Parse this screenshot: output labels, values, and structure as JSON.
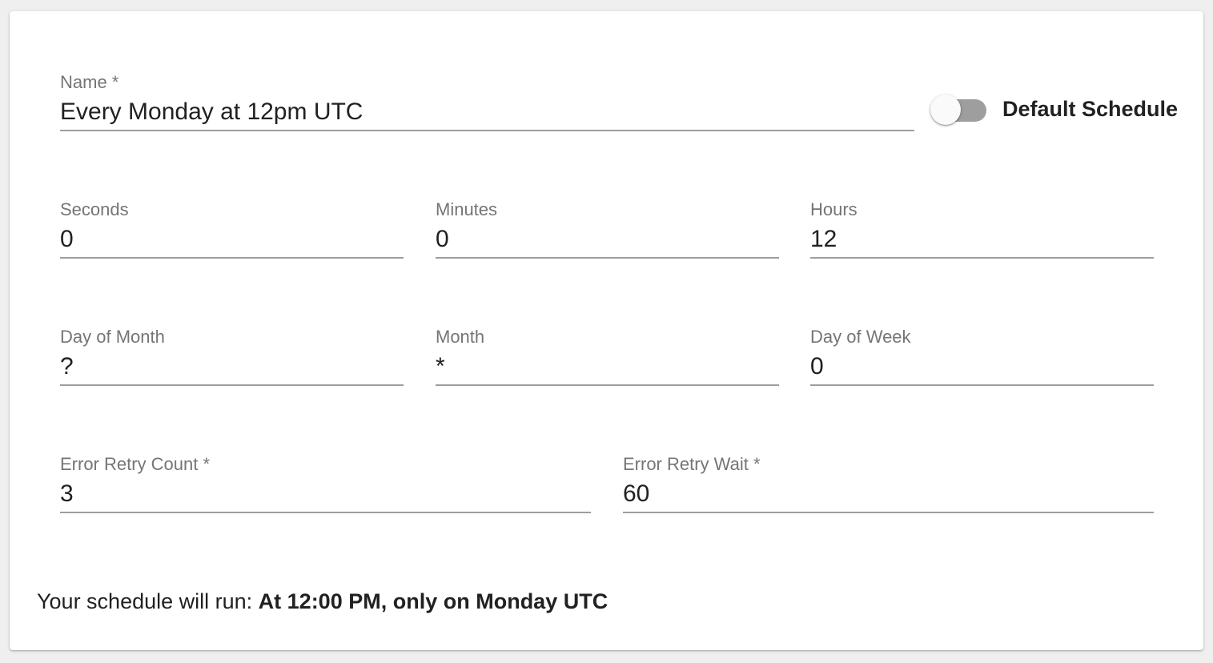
{
  "form": {
    "name": {
      "label": "Name *",
      "value": "Every Monday at 12pm UTC"
    },
    "default_schedule": {
      "label": "Default Schedule",
      "checked": false
    },
    "seconds": {
      "label": "Seconds",
      "value": "0"
    },
    "minutes": {
      "label": "Minutes",
      "value": "0"
    },
    "hours": {
      "label": "Hours",
      "value": "12"
    },
    "day_of_month": {
      "label": "Day of Month",
      "value": "?"
    },
    "month": {
      "label": "Month",
      "value": "*"
    },
    "day_of_week": {
      "label": "Day of Week",
      "value": "0"
    },
    "error_retry_count": {
      "label": "Error Retry Count *",
      "value": "3"
    },
    "error_retry_wait": {
      "label": "Error Retry Wait *",
      "value": "60"
    }
  },
  "summary": {
    "prefix": "Your schedule will run: ",
    "description": "At 12:00 PM, only on Monday UTC"
  },
  "colors": {
    "label": "#757575",
    "text": "#212121",
    "underline": "#9e9e9e",
    "switch_track": "#9e9e9e",
    "switch_thumb": "#fafafa",
    "background": "#efefef",
    "card": "#ffffff"
  }
}
